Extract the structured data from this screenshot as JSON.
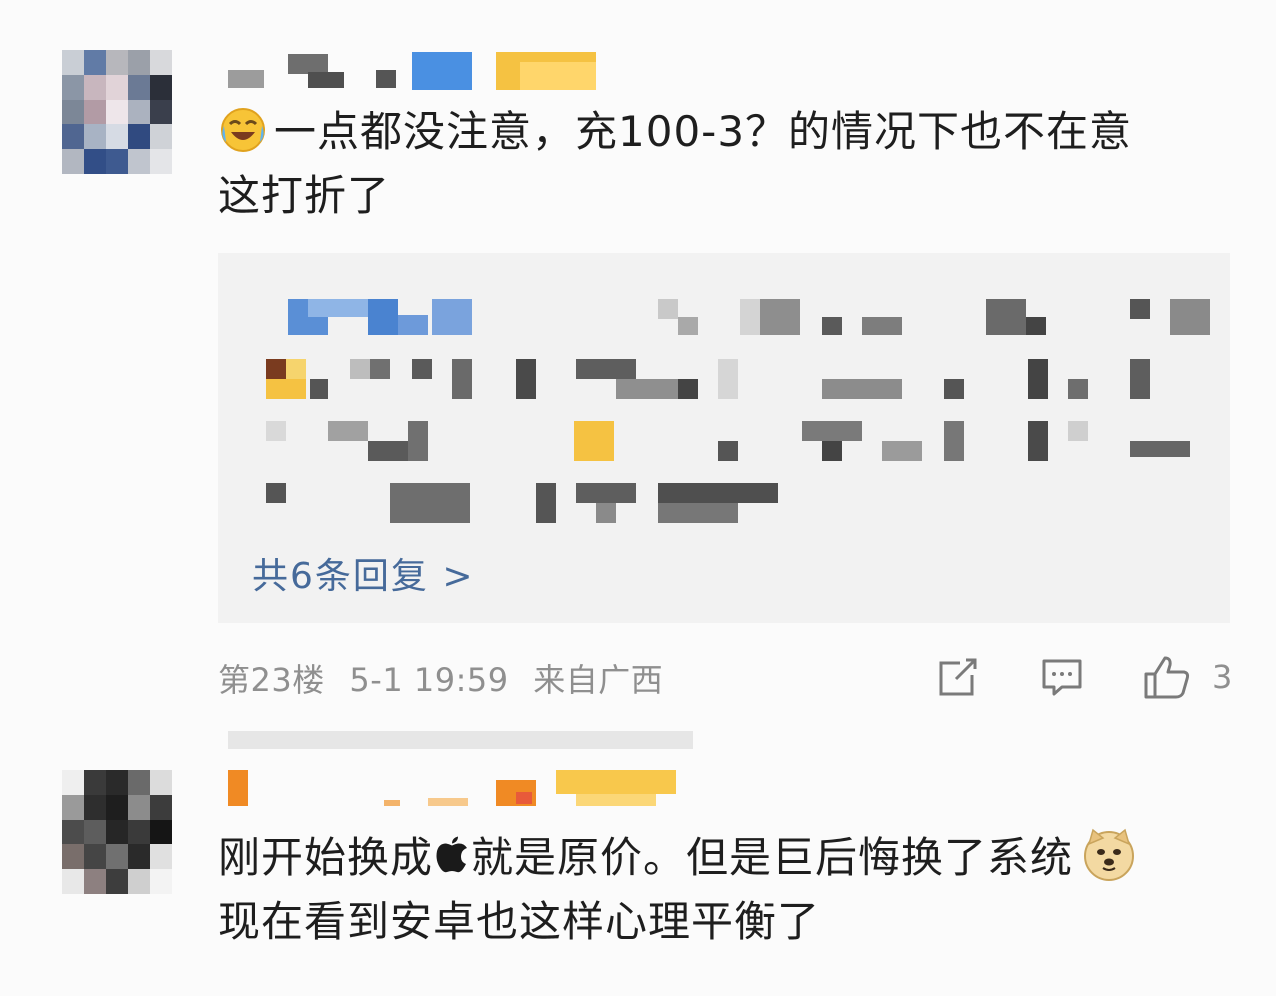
{
  "comments": [
    {
      "text_line1": "一点都没注意，充100-3？的情况下也不在意",
      "text_line2": "这打折了",
      "emoji": "laugh-cry-emoji",
      "replies_link": "共6条回复 >",
      "floor": "第23楼",
      "date": "5-1 19:59",
      "location": "来自广西",
      "like_count": "3"
    },
    {
      "text_before_icon": "刚开始换成",
      "text_after_icon": "就是原价。但是巨后悔换了系统",
      "text_line2": "现在看到安卓也这样心理平衡了",
      "inline_icon": "apple-logo-icon",
      "emoji": "doge-emoji"
    }
  ],
  "icons": {
    "share": "share-icon",
    "comment": "comment-icon",
    "like": "thumbs-up-icon"
  },
  "colors": {
    "link": "#466a9a",
    "meta": "#8f8f8f",
    "reply_bg": "#f2f2f2"
  }
}
